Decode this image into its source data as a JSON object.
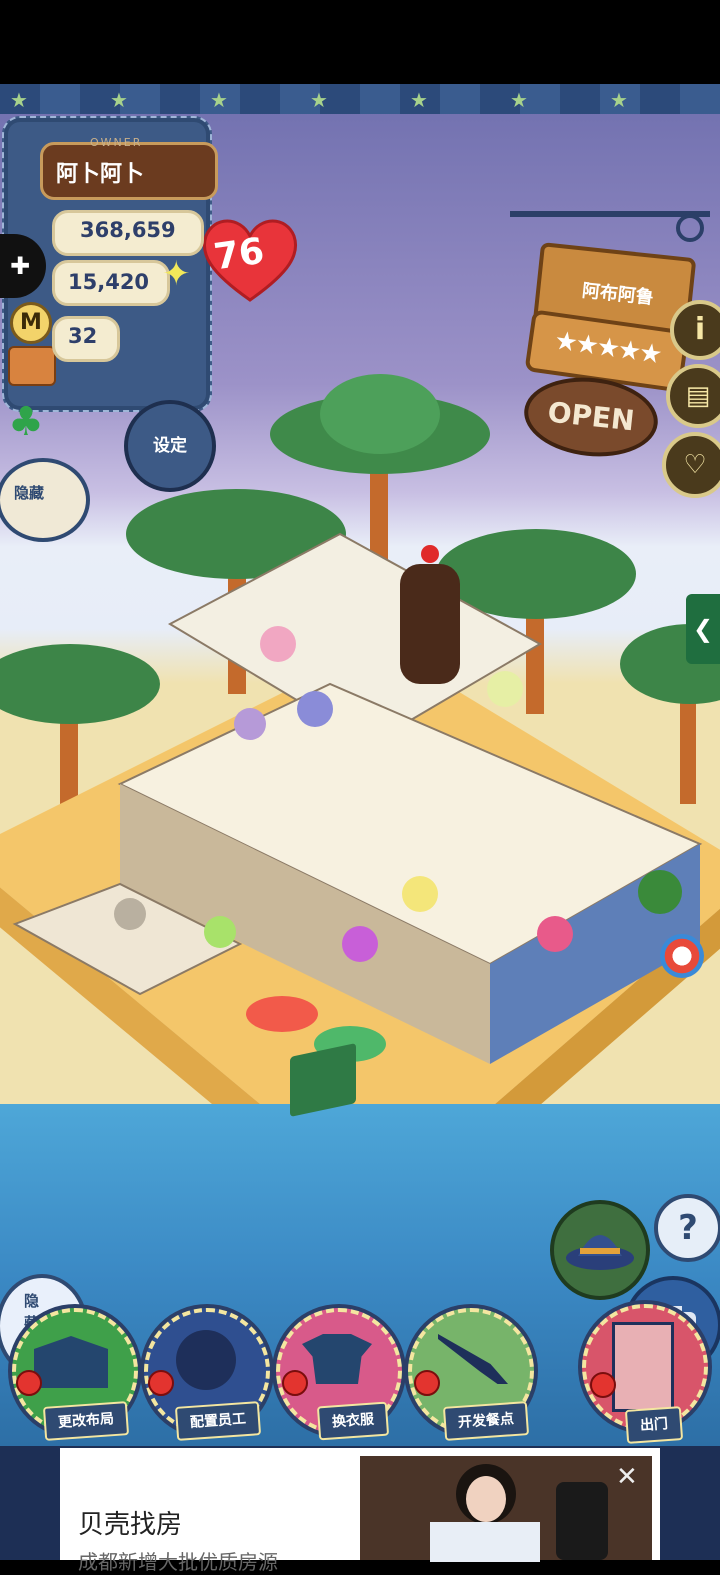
{
  "owner": {
    "label": "OWNER",
    "name": "阿卜阿卜",
    "level": "76"
  },
  "stats": {
    "coins": "368,659",
    "food": "15,420",
    "clover": "32",
    "coin_icon": "M"
  },
  "buttons": {
    "settings": "设定",
    "hide_top": "隐藏",
    "hide_bottom": "隐藏",
    "help": "?"
  },
  "shop_sign": {
    "name": "阿布阿鲁",
    "stars": "★★★★★",
    "open": "OPEN"
  },
  "side_icons": {
    "info": "i"
  },
  "actions": [
    {
      "label": "更改布局",
      "color": "#3fa04a"
    },
    {
      "label": "配置员工",
      "color": "#2f4f90"
    },
    {
      "label": "换衣服",
      "color": "#d85a8a"
    },
    {
      "label": "开发餐点",
      "color": "#77b46a"
    },
    {
      "label": "出门",
      "color": "#d8556a"
    }
  ],
  "ad": {
    "title": "贝壳找房",
    "subtitle": "成都新增大批优质房源"
  }
}
